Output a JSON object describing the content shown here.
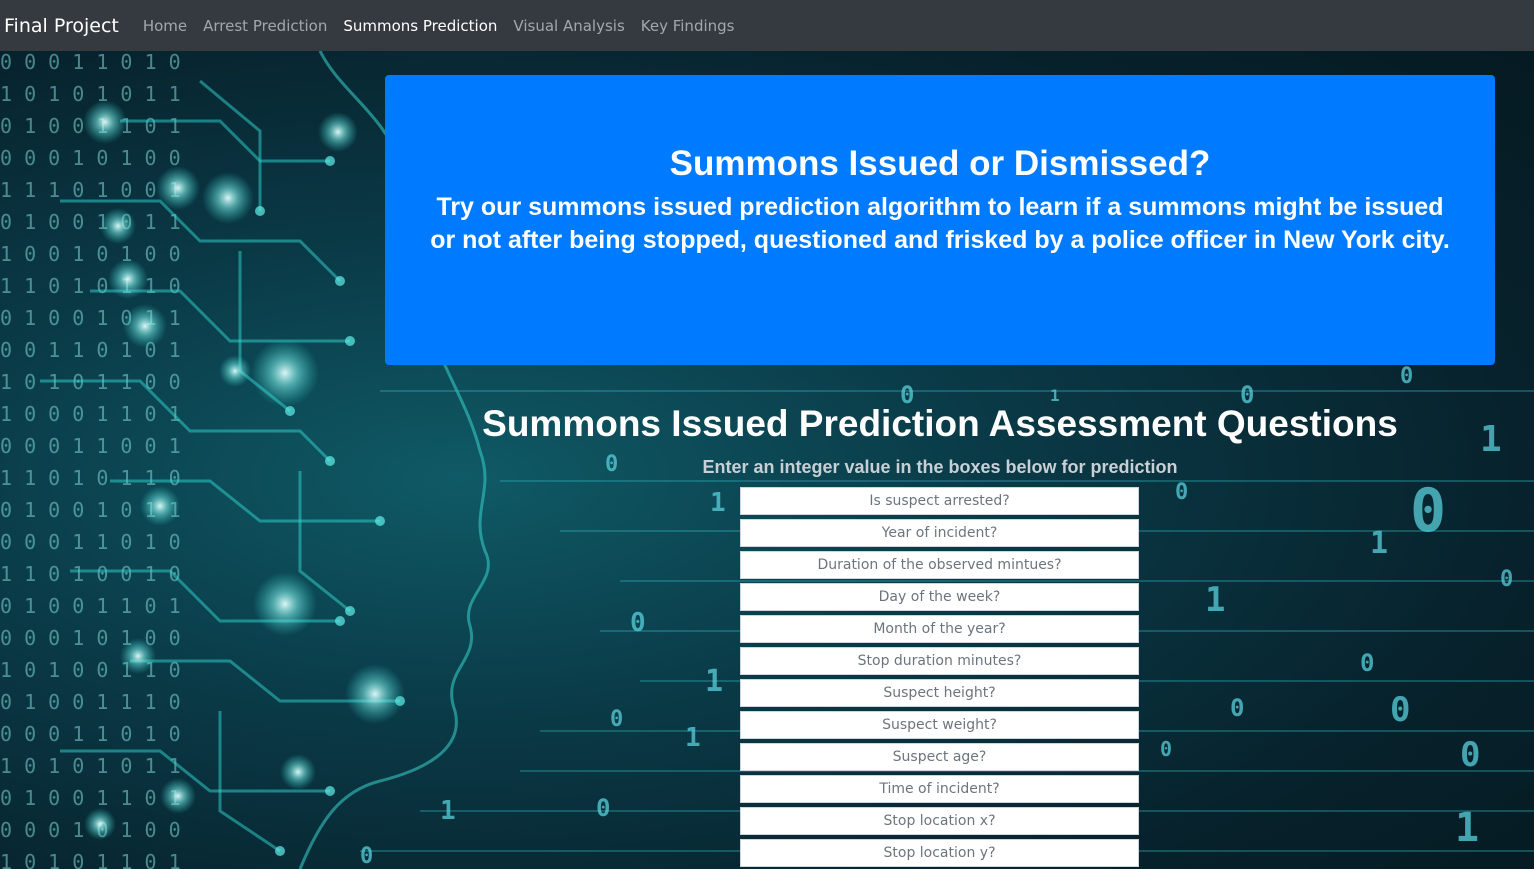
{
  "navbar": {
    "brand": "Final Project",
    "links": [
      {
        "label": "Home",
        "active": false
      },
      {
        "label": "Arrest Prediction",
        "active": false
      },
      {
        "label": "Summons Prediction",
        "active": true
      },
      {
        "label": "Visual Analysis",
        "active": false
      },
      {
        "label": "Key Findings",
        "active": false
      }
    ]
  },
  "jumbotron": {
    "title": "Summons Issued or Dismissed?",
    "lead": "Try our summons issued prediction algorithm to learn if a summons might be issued or not after being stopped, questioned and frisked by a police officer in New York city."
  },
  "form": {
    "title": "Summons Issued Prediction Assessment Questions",
    "subtitle": "Enter an integer value in the boxes below for prediction",
    "fields": [
      {
        "placeholder": "Is suspect arrested?"
      },
      {
        "placeholder": "Year of incident?"
      },
      {
        "placeholder": "Duration of the observed mintues?"
      },
      {
        "placeholder": "Day of the week?"
      },
      {
        "placeholder": "Month of the year?"
      },
      {
        "placeholder": "Stop duration minutes?"
      },
      {
        "placeholder": "Suspect height?"
      },
      {
        "placeholder": "Suspect weight?"
      },
      {
        "placeholder": "Suspect age?"
      },
      {
        "placeholder": "Time of incident?"
      },
      {
        "placeholder": "Stop location x?"
      },
      {
        "placeholder": "Stop location y?"
      }
    ]
  },
  "colors": {
    "navbar": "#343a40",
    "jumbotron": "#007bff",
    "background": "#0a3a47",
    "accent_teal": "#2fd6d0"
  },
  "background_image": "circuit-head-binary-digits"
}
